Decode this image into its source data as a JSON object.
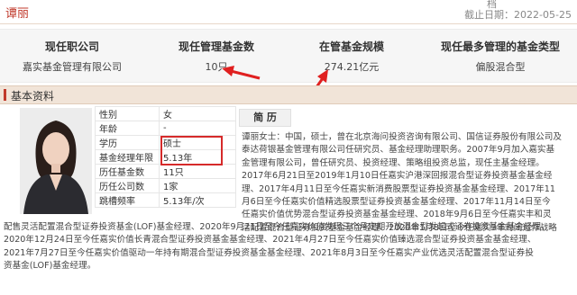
{
  "header": {
    "manager_name": "谭丽",
    "deadline": "截止日期：2022-05-25",
    "top_stub": "档"
  },
  "stats": [
    {
      "label": "现任职公司",
      "value": "嘉实基金管理有限公司"
    },
    {
      "label": "现任管理基金数",
      "value": "10只"
    },
    {
      "label": "在管基金规模",
      "value": "274.21亿元"
    },
    {
      "label": "现任最多管理的基金类型",
      "value": "偏股混合型"
    }
  ],
  "section": {
    "title": "基本资料"
  },
  "profile": [
    {
      "k": "性别",
      "v": "女"
    },
    {
      "k": "年龄",
      "v": "-"
    },
    {
      "k": "学历",
      "v": "硕士"
    },
    {
      "k": "基金经理年限",
      "v": "5.13年"
    },
    {
      "k": "历任基金数",
      "v": "11只"
    },
    {
      "k": "历任公司数",
      "v": "1家"
    },
    {
      "k": "跳槽频率",
      "v": "5.13年/次"
    }
  ],
  "resume": {
    "title": "简 历",
    "lines_right": [
      "谭丽女士：中国，硕士，曾在北京海问投资咨询有限公司、国信证券股份有限公司及",
      "泰达荷银基金管理有限公司任研究员、基金经理助理职务。2007年9月加入嘉实基",
      "金管理有限公司，曾任研究员、投资经理、策略组投资总监，现任主基金经理。",
      "2017年6月21日至2019年1月10日任嘉实沪港深回报混合型证券投资基金基金经",
      "理、2017年4月11日至今任嘉实新消费股票型证券投资基金基金经理、2017年11",
      "月6日至今任嘉实价值精选股票型证券投资基金基金经理、2017年11月14日至今",
      "任嘉实价值优势混合型证券投资基金基金经理、2018年9月6日至今任嘉实丰和灵",
      "活配置混合型证券投资基金基金经理、2020年1月8日至今任嘉实3年封闭运作战略"
    ],
    "lines_full": [
      "配售灵活配置混合型证券投资基金(LOF)基金经理、2020年9月21日至今任嘉实价值发现三个月定期开放混合型发起式证券投资基金基金经理、",
      "2020年12月24日至今任嘉实价值长青混合型证券投资基金基金经理、2021年4月27日至今任嘉实价值臻选混合型证券投资基金基金经理、",
      "2021年7月27日至今任嘉实价值驱动一年持有期混合型证券投资基金基金经理、2021年8月3日至今任嘉实产业优选灵活配置混合型证券投",
      "资基金(LOF)基金经理。"
    ]
  },
  "colors": {
    "accent": "#c0392b",
    "highlight_box": "#d62a2a",
    "arrow": "#e02020",
    "section_bg": "#f1e4d8"
  }
}
